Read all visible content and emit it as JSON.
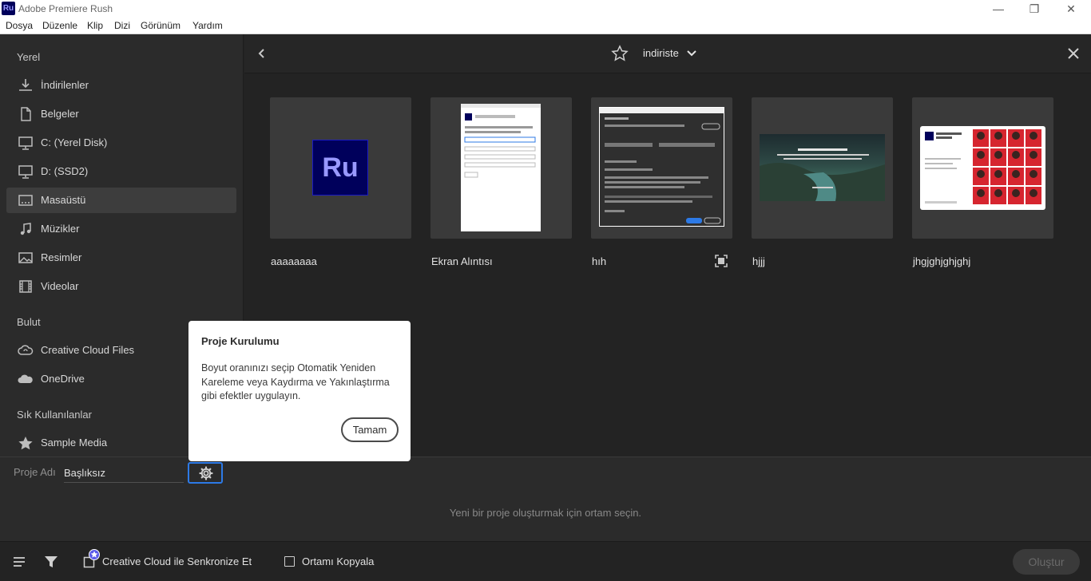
{
  "window": {
    "app_icon": "Ru",
    "title": "Adobe Premiere Rush",
    "controls": {
      "minimize": "—",
      "restore": "❐",
      "close": "✕"
    }
  },
  "menu": [
    "Dosya",
    "Düzenle",
    "Klip",
    "Dizi",
    "Görünüm",
    "Yardım"
  ],
  "sidebar": {
    "local_label": "Yerel",
    "local_items": [
      {
        "label": "İndirilenler",
        "icon": "download-icon"
      },
      {
        "label": "Belgeler",
        "icon": "document-icon"
      },
      {
        "label": "C: (Yerel Disk)",
        "icon": "monitor-icon"
      },
      {
        "label": "D: (SSD2)",
        "icon": "monitor-icon"
      },
      {
        "label": "Masaüstü",
        "icon": "desktop-icon",
        "active": true
      },
      {
        "label": "Müzikler",
        "icon": "music-icon"
      },
      {
        "label": "Resimler",
        "icon": "image-icon"
      },
      {
        "label": "Videolar",
        "icon": "film-icon"
      }
    ],
    "cloud_label": "Bulut",
    "cloud_items": [
      {
        "label": "Creative Cloud Files",
        "icon": "creative-cloud-icon"
      },
      {
        "label": "OneDrive",
        "icon": "cloud-icon"
      }
    ],
    "favorites_label": "Sık Kullanılanlar",
    "favorite_items": [
      {
        "label": "Sample Media",
        "icon": "star-filled-icon"
      }
    ]
  },
  "browser": {
    "folder_name": "indiriste",
    "files": [
      {
        "name": "aaaaaaaa",
        "thumb": "ru-logo",
        "logo_text": "Ru"
      },
      {
        "name": "Ekran Alıntısı",
        "thumb": "document"
      },
      {
        "name": "hıh",
        "thumb": "dialog"
      },
      {
        "name": "hjjj",
        "thumb": "landscape"
      },
      {
        "name": "jhgjghjghjghj",
        "thumb": "collage"
      }
    ]
  },
  "popup": {
    "title": "Proje Kurulumu",
    "body": "Boyut oranınızı seçip Otomatik Yeniden Kareleme veya Kaydırma ve Yakınlaştırma gibi efektler uygulayın.",
    "ok_label": "Tamam"
  },
  "project": {
    "name_label": "Proje Adı",
    "name_value": "Başlıksız",
    "hint": "Yeni bir proje oluşturmak için ortam seçin."
  },
  "footer": {
    "sync_label": "Creative Cloud ile Senkronize Et",
    "copy_label": "Ortamı Kopyala",
    "create_label": "Oluştur"
  },
  "colors": {
    "accent_blue": "#2d7ae6",
    "ru_brand": "#00005b",
    "ru_text": "#9999ff"
  }
}
